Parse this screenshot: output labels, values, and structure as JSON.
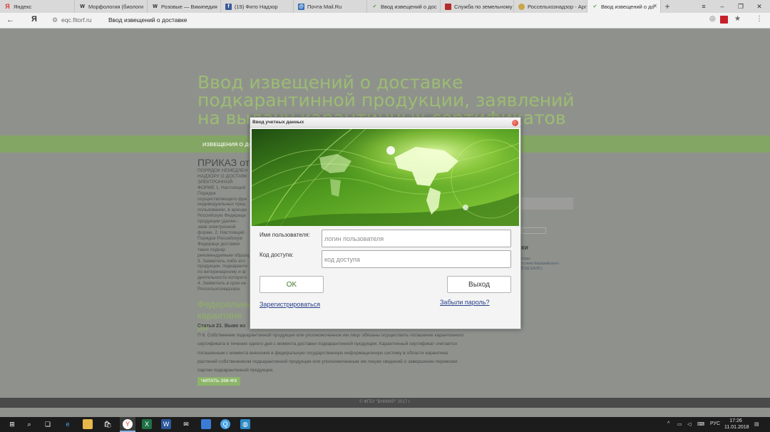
{
  "browser": {
    "tabs": [
      {
        "label": "Яндекс",
        "icon": "yandex-icon",
        "active": false
      },
      {
        "label": "Морфология (биологи",
        "icon": "wikipedia-icon",
        "active": false
      },
      {
        "label": "Розовые — Википедия",
        "icon": "wikipedia-icon",
        "active": false
      },
      {
        "label": "(19) Фито Надзор",
        "icon": "facebook-icon",
        "active": false
      },
      {
        "label": "Почта Mail.Ru",
        "icon": "mail-icon",
        "active": false
      },
      {
        "label": "Ввод извещений о дос",
        "icon": "fitorf-icon",
        "active": false
      },
      {
        "label": "Служба по земельному",
        "icon": "land-service-icon",
        "active": false
      },
      {
        "label": "Россельхознадзор - Apr",
        "icon": "rosselkhoz-icon",
        "active": false
      },
      {
        "label": "Ввод извещений о до",
        "icon": "fitorf-icon",
        "active": true
      }
    ],
    "address": {
      "domain": "eqc.fitorf.ru",
      "page_title": "Ввод извещений о доставке"
    }
  },
  "page": {
    "title": "Ввод извещений о доставке подкарантинной продукции, заявлений на выдачу карантинных сертификатов",
    "nav_item": "ИЗВЕЩЕНИЯ О ДО",
    "prikaz": "ПРИКАЗ от",
    "left_text": "ПОРЯДОК НЕМЕДЛЕН НАДЗОРУ О ДОСТАВК ЭЛЕКТРОННОЙ ФОРМЕ 1. Настоящий Порядок осуществляющего фун индивидуальных пред пользовании, в аренде Российскую Федераци продукции (далее - заяв электронной форме. 2. Настоящий Порядок Российскую Федераци доставке таких подкар рекомендуемым образц 3. Заявитель либо его продукции, подкаранти по ветеринарному и ф деятельности которого 4. Заявитель в срок не Россельхознадзора. Извещение передается официальный сайт упр",
    "federal_heading": "Федеральны карантине ра",
    "article": "Статья 21. Выво из",
    "paragraph": "П 6. Собственник подкарантинной продукции или уполномоченное им лицо обязаны осуществить погашение карантинного сертификата в течение одного дня с момента доставки подкарантинной продукции. Карантинный сертификат считается погашенным с момента внесения в федеральную государственную информационную систему в области карантина растений собственником подкарантинной продукции или уполномоченным им лицом сведений о завершении перевозки партии подкарантинной продукции.",
    "read_button": "ЧИТАТЬ 206-ФЗ",
    "side_heading": "ки",
    "side_links": [
      "ходы",
      "тствии Евразийского",
      "ВЭД ЕАЭС)"
    ],
    "footer": "© ФГБУ \"ВНИИКР\" 2017 г."
  },
  "dialog": {
    "title": "Ввод учетных данных",
    "username_label": "Имя пользователя:",
    "username_placeholder": "логин пользователя",
    "code_label": "Код доступа:",
    "code_placeholder": "код доступа",
    "ok_label": "OK",
    "exit_label": "Выход",
    "register_link": "Зарегистрироваться",
    "forgot_link": "Забыли пароль?",
    "accent_color": "#3f7a2a",
    "link_color": "#27408b"
  },
  "taskbar": {
    "icons": [
      "windows-start-icon",
      "search-icon",
      "task-view-icon",
      "edge-icon",
      "file-explorer-icon",
      "store-icon",
      "yandex-browser-icon",
      "excel-icon",
      "word-icon",
      "mail-icon",
      "photos-icon",
      "search-app-icon",
      "globe-icon"
    ],
    "language": "РУС",
    "time": "17:26",
    "date": "11.01.2018"
  }
}
